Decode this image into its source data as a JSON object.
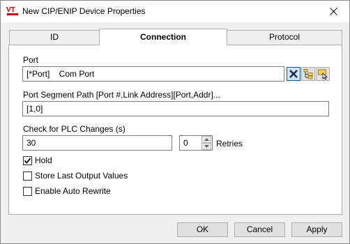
{
  "window": {
    "title": "New CIP/ENIP Device Properties",
    "app_icon": "vt-logo-icon",
    "close_icon": "close-icon"
  },
  "tabs": [
    {
      "label": "ID",
      "active": false
    },
    {
      "label": "Connection",
      "active": true
    },
    {
      "label": "Protocol",
      "active": false
    }
  ],
  "connection": {
    "port_label": "Port",
    "port_value": "[*Port]    Com Port",
    "port_buttons": [
      {
        "icon": "clear-x-icon",
        "selected": true
      },
      {
        "icon": "browse-tree-icon",
        "selected": false
      },
      {
        "icon": "select-pointer-icon",
        "selected": false
      }
    ],
    "segment_label": "Port Segment Path [Port #,Link Address][Port,Addr]...",
    "segment_value": "[1,0]",
    "check_label": "Check for PLC Changes (s)",
    "check_value": "30",
    "retries_value": "0",
    "retries_label": "Retries",
    "checkboxes": [
      {
        "label": "Hold",
        "checked": true
      },
      {
        "label": "Store Last Output Values",
        "checked": false
      },
      {
        "label": "Enable Auto Rewrite",
        "checked": false
      }
    ]
  },
  "buttons": {
    "ok": "OK",
    "cancel": "Cancel",
    "apply": "Apply"
  }
}
